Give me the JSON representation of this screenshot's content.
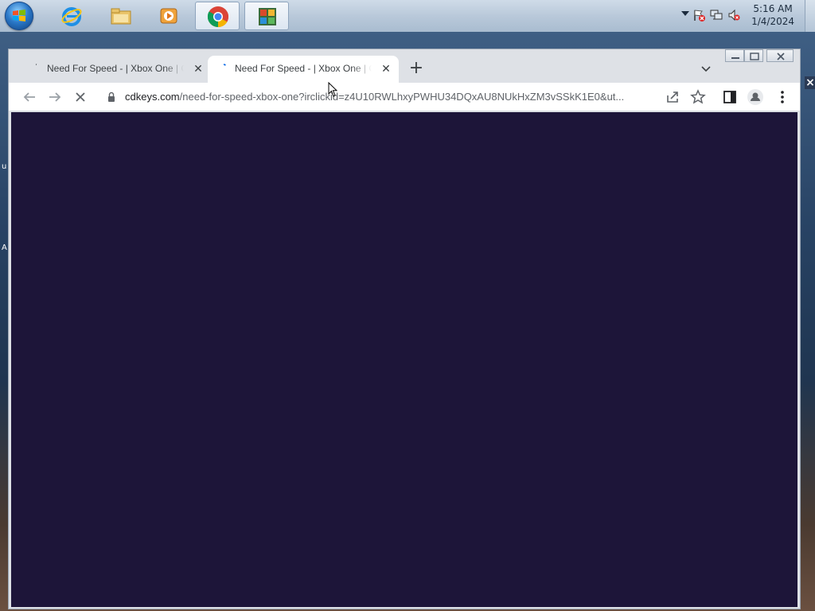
{
  "taskbar": {
    "apps": [
      {
        "name": "internet-explorer",
        "icon": "ie-icon"
      },
      {
        "name": "file-explorer",
        "icon": "folder-icon"
      },
      {
        "name": "media-player",
        "icon": "media-player-icon"
      },
      {
        "name": "google-chrome",
        "icon": "chrome-icon",
        "active": true
      },
      {
        "name": "avg-antivirus",
        "icon": "avg-icon",
        "active": true
      }
    ],
    "clock": {
      "time": "5:16 AM",
      "date": "1/4/2024"
    }
  },
  "browser": {
    "tabs": [
      {
        "title": "Need For Speed - | Xbox One | CDKeys",
        "active": false
      },
      {
        "title": "Need For Speed - | Xbox One | CDKeys",
        "active": true
      }
    ],
    "url": {
      "host": "cdkeys.com",
      "path": "/need-for-speed-xbox-one?irclickid=z4U10RWLhxyPWHU34DQxAU8NUkHxZM3vSSkK1E0&ut..."
    },
    "page_background": "#1d1539"
  },
  "desktop": {
    "edge_letters": [
      "u",
      "A"
    ]
  },
  "colors": {
    "tab_strip": "#dee1e6",
    "active_tab": "#ffffff",
    "viewport": "#1d1539"
  }
}
